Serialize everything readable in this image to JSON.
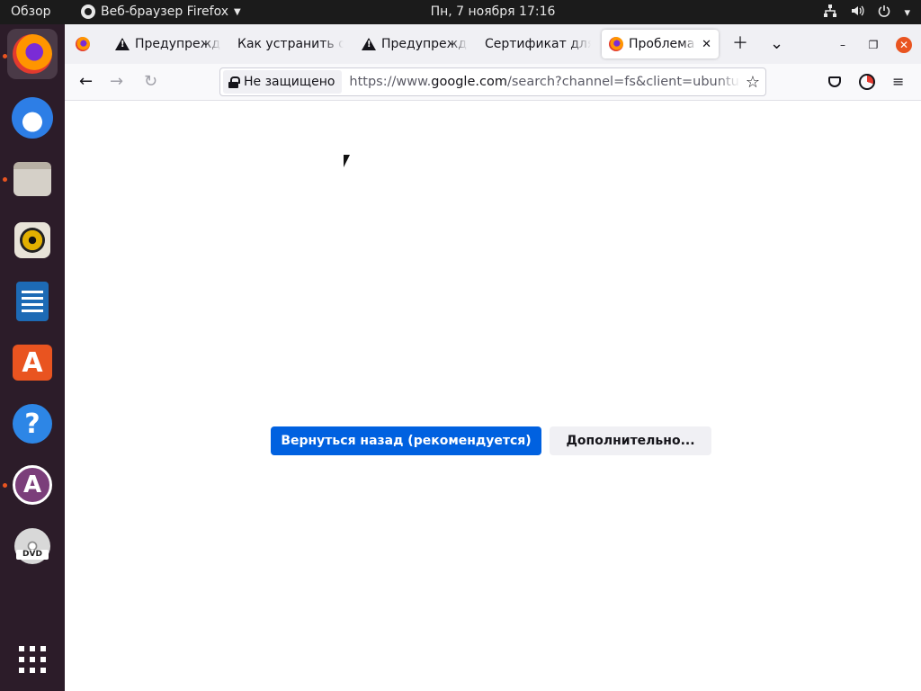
{
  "topbar": {
    "activities": "Обзор",
    "app_name": "Веб-браузер Firefox",
    "clock": "Пн, 7 ноября  17:16"
  },
  "dock": {
    "items": [
      {
        "name": "firefox",
        "active": true
      },
      {
        "name": "thunderbird"
      },
      {
        "name": "files"
      },
      {
        "name": "rhythmbox"
      },
      {
        "name": "libreoffice-writer"
      },
      {
        "name": "software"
      },
      {
        "name": "help"
      },
      {
        "name": "software-updater"
      },
      {
        "name": "dvd"
      },
      {
        "name": "show-applications"
      }
    ],
    "dvd_label": "DVD"
  },
  "tabs": [
    {
      "label": "",
      "icon": "firefox-icon"
    },
    {
      "label": "Предупреждение",
      "icon": "warning-icon"
    },
    {
      "label": "Как устранить ошибку",
      "icon": ""
    },
    {
      "label": "Предупреждение",
      "icon": "warning-icon"
    },
    {
      "label": "Сертификат для",
      "icon": ""
    },
    {
      "label": "Проблема при",
      "icon": "firefox-icon",
      "selected": true
    }
  ],
  "navbar": {
    "identity_label": "Не защищено",
    "url_scheme": "https://www.",
    "url_host": "google.com",
    "url_path": "/search?channel=fs&client=ubuntu&q"
  },
  "content": {
    "primary_button": "Вернуться назад (рекомендуется)",
    "secondary_button": "Дополнительно..."
  },
  "colors": {
    "primary": "#0061e0",
    "dock_bg": "#2c1c29",
    "topbar_bg": "#1b1b1b",
    "accent": "#e95420"
  }
}
